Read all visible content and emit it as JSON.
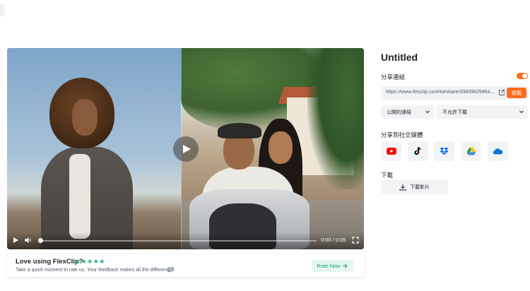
{
  "video": {
    "time": "0:00 / 0:05",
    "progress": 0.0
  },
  "rating": {
    "title": "Love using FlexClip?",
    "stars": "★★★★★",
    "subtitle": "Take a quick moment to rate us. Your feedback makes all the difference!",
    "button_label": "Rate Now",
    "accent": "#18b37d"
  },
  "panel": {
    "title": "Untitled",
    "share_link_label": "分享連結",
    "share_link_enabled": true,
    "share_url": "https://www.flexclip.com/tw/share/3360962946aeafc...",
    "copy_label": "複製",
    "visibility_value": "公開的連結",
    "download_permission_value": "不允許下載",
    "social_label": "分享到社交媒體",
    "social": [
      {
        "icon": "youtube-icon",
        "color": "#ff0000"
      },
      {
        "icon": "tiktok-icon",
        "color": "#000000"
      },
      {
        "icon": "dropbox-icon",
        "color": "#0061ff"
      },
      {
        "icon": "google-drive-icon",
        "color": "#1fa463"
      },
      {
        "icon": "onedrive-icon",
        "color": "#0f78d4"
      }
    ],
    "download_label": "下載",
    "download_button": "下載影片",
    "accent": "#ff6b1a"
  }
}
